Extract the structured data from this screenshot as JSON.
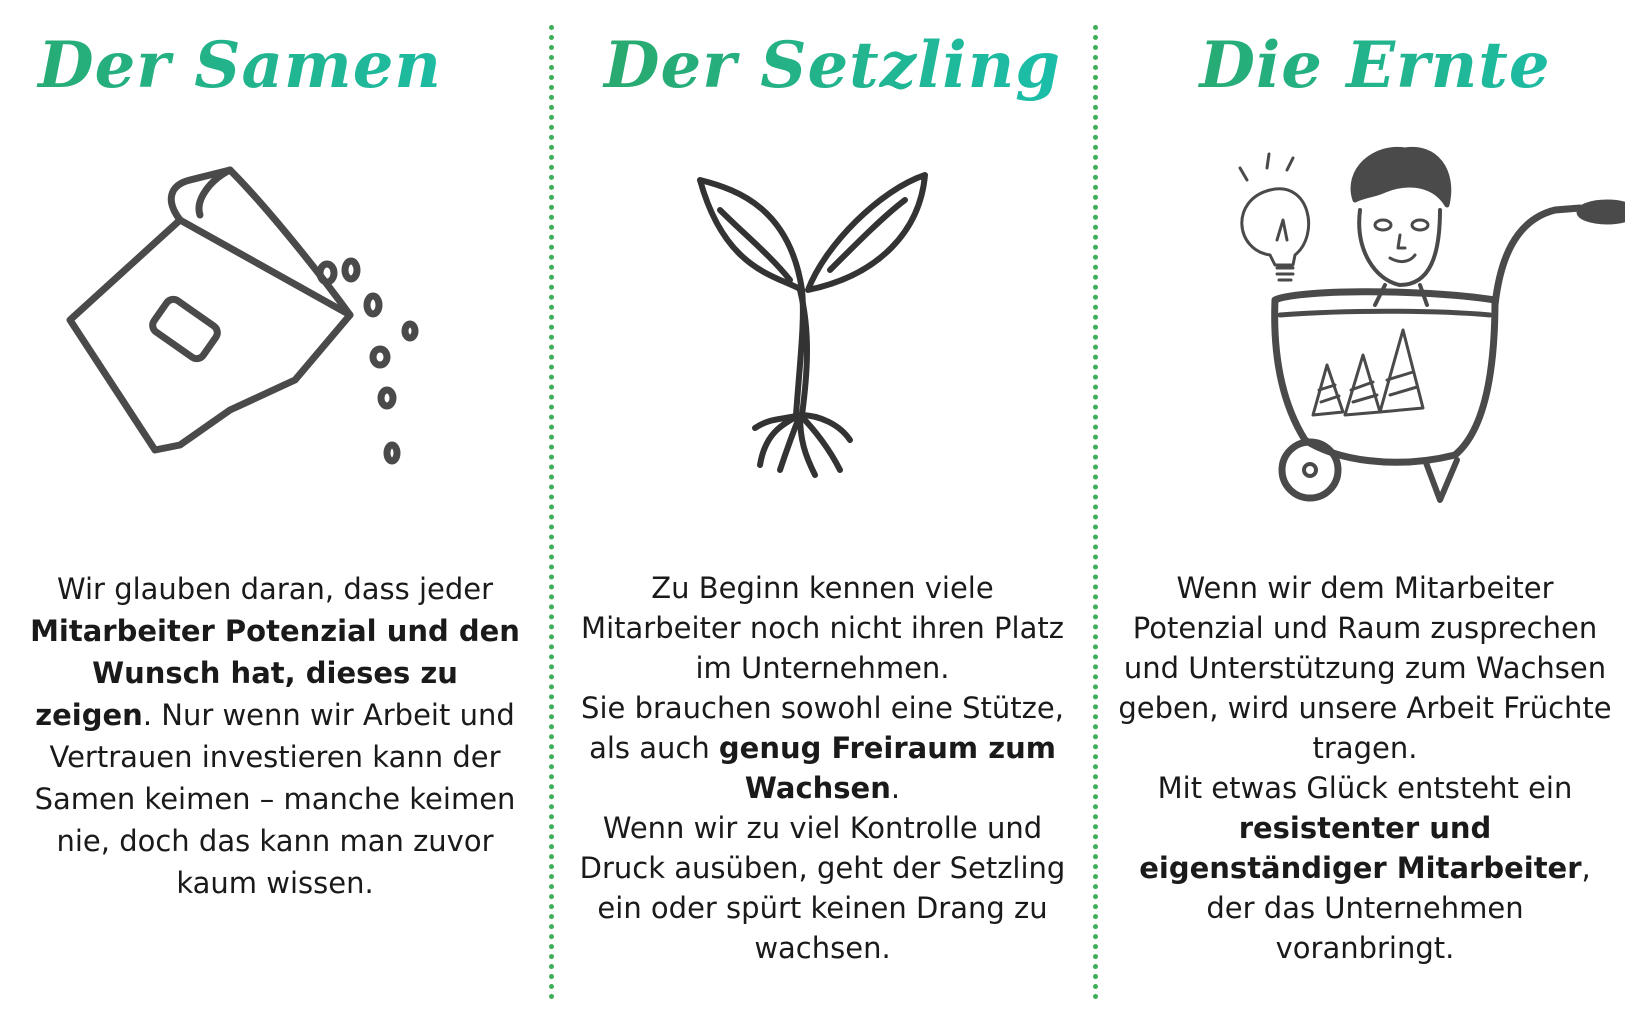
{
  "accent_color": "#3fae5a",
  "heading_gradient": [
    "#2aa86a",
    "#1bbfae"
  ],
  "columns": [
    {
      "title": "Der Samen",
      "icon": "seed-bag-icon",
      "text": {
        "p1": "Wir glauben daran, dass jeder ",
        "b1": "Mitarbeiter Potenzial und den Wunsch hat, dieses zu zeigen",
        "p2": ". Nur wenn wir Arbeit und Vertrauen investieren kann der Samen keimen – manche keimen nie, doch das kann man zuvor kaum wissen."
      }
    },
    {
      "title": "Der Setzling",
      "icon": "seedling-icon",
      "text": {
        "p1": "Zu Beginn kennen viele Mitarbeiter noch nicht ihren Platz im Unternehmen.",
        "p2": "Sie brauchen sowohl eine Stütze, als auch ",
        "b1": "genug Freiraum zum Wachsen",
        "p3": ".",
        "p4": "Wenn wir zu viel Kontrolle und Druck ausüben, geht der Setzling ein oder spürt keinen Drang zu wachsen."
      }
    },
    {
      "title": "Die Ernte",
      "icon": "wheelbarrow-person-icon",
      "text": {
        "p1": "Wenn wir dem Mitarbeiter Potenzial und Raum zusprechen und Unterstützung zum Wachsen geben, wird unsere Arbeit Früchte tragen.",
        "p2": "Mit etwas Glück entsteht ein ",
        "b1": "resistenter und eigenständiger Mitarbeiter",
        "p3": ", der das  Unternehmen voranbringt."
      }
    }
  ]
}
